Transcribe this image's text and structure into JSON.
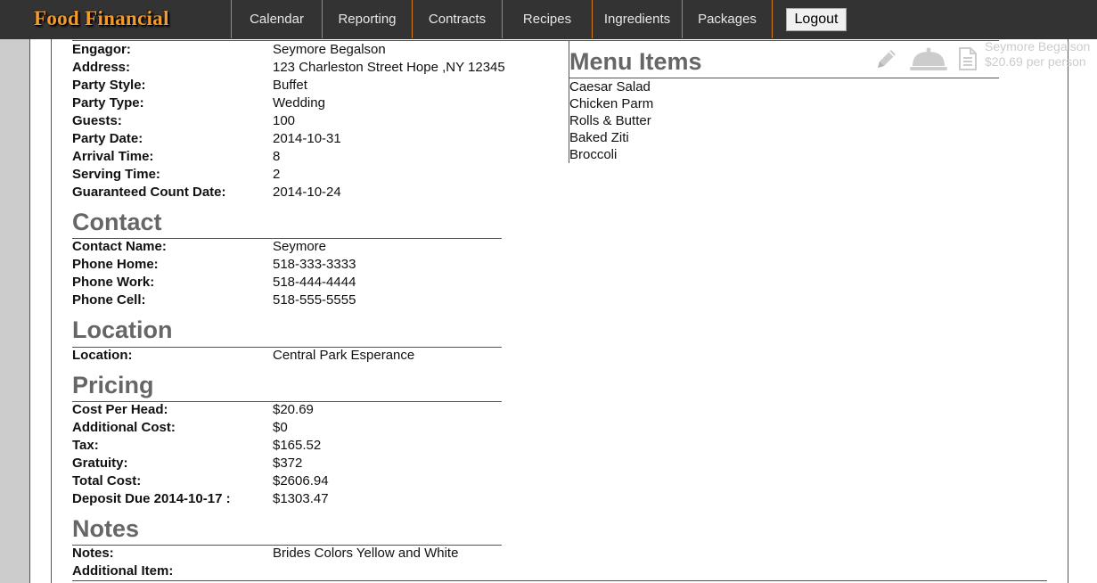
{
  "app": {
    "brand": "Food Financial"
  },
  "nav": {
    "items": [
      "Calendar",
      "Reporting",
      "Contracts",
      "Recipes",
      "Ingredients",
      "Packages"
    ],
    "logout_label": "Logout"
  },
  "event": [
    {
      "label": "Engagor:",
      "value": "Seymore Begalson"
    },
    {
      "label": "Address:",
      "value": "123 Charleston Street Hope ,NY 12345"
    },
    {
      "label": "Party Style:",
      "value": "Buffet"
    },
    {
      "label": "Party Type:",
      "value": "Wedding"
    },
    {
      "label": "Guests:",
      "value": "100"
    },
    {
      "label": "Party Date:",
      "value": "2014-10-31"
    },
    {
      "label": "Arrival Time:",
      "value": "8"
    },
    {
      "label": "Serving Time:",
      "value": "2"
    },
    {
      "label": "Guaranteed Count Date:",
      "value": "2014-10-24"
    }
  ],
  "contact": {
    "heading": "Contact",
    "rows": [
      {
        "label": "Contact Name:",
        "value": "Seymore"
      },
      {
        "label": "Phone Home:",
        "value": "518-333-3333"
      },
      {
        "label": "Phone Work:",
        "value": "518-444-4444"
      },
      {
        "label": "Phone Cell:",
        "value": "518-555-5555"
      }
    ]
  },
  "location": {
    "heading": "Location",
    "rows": [
      {
        "label": "Location:",
        "value": "Central Park Esperance"
      }
    ]
  },
  "pricing": {
    "heading": "Pricing",
    "rows": [
      {
        "label": "Cost Per Head:",
        "value": "$20.69"
      },
      {
        "label": "Additional Cost:",
        "value": "$0"
      },
      {
        "label": "Tax:",
        "value": "$165.52"
      },
      {
        "label": "Gratuity:",
        "value": "$372"
      },
      {
        "label": "Total Cost:",
        "value": "$2606.94"
      },
      {
        "label": "Deposit Due 2014-10-17 :",
        "value": "$1303.47"
      }
    ]
  },
  "notes": {
    "heading": "Notes",
    "rows": [
      {
        "label": "Notes:",
        "value": "Brides Colors Yellow and White"
      },
      {
        "label": "Additional Item:",
        "value": ""
      }
    ]
  },
  "menu": {
    "heading": "Menu Items",
    "items": [
      "Caesar Salad",
      "Chicken Parm",
      "Rolls & Butter",
      "Baked Ziti",
      "Broccoli"
    ]
  },
  "summary": {
    "name": "Seymore Begalson",
    "price": "$20.69 per person"
  },
  "icons": [
    "pencil-icon",
    "serving-cloche-icon",
    "document-icon"
  ],
  "colors": {
    "navbar": "#333333",
    "brand": "#f49a2a",
    "nav_divider": "#d27c1c",
    "heading": "#666666",
    "gutter": "#cccccc"
  }
}
